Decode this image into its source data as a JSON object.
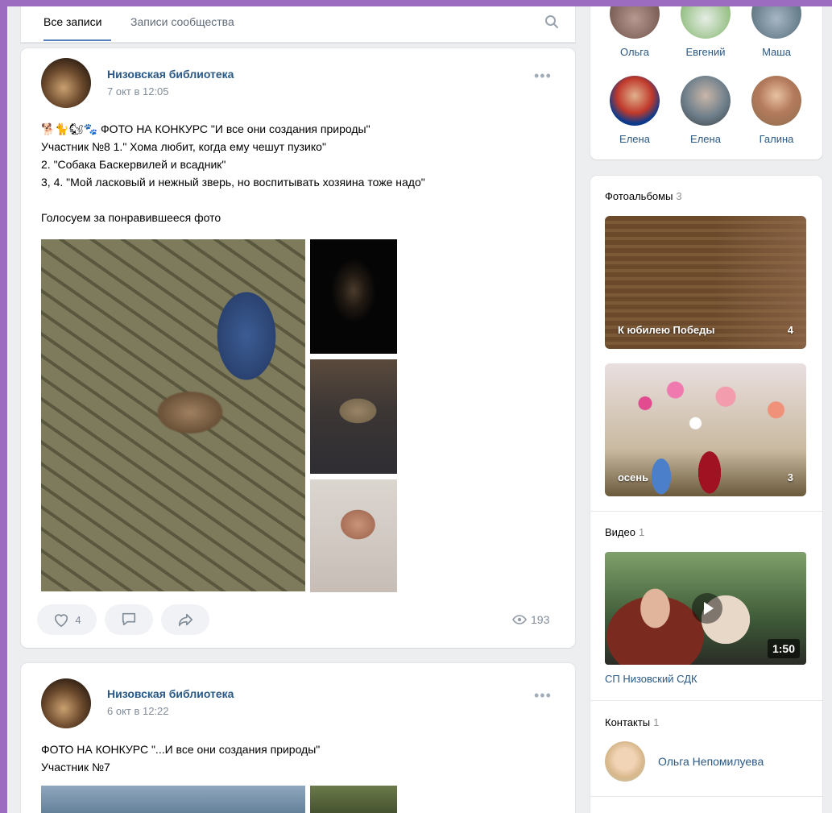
{
  "tabs": {
    "all": "Все записи",
    "community": "Записи сообщества"
  },
  "posts": [
    {
      "author": "Низовская библиотека",
      "date": "7 окт в 12:05",
      "more": "•••",
      "text": "🐕🐈🐿🐾 ФОТО НА КОНКУРС \"И все они создания природы\"\nУчастник №8 1.\" Хома любит, когда ему чешут пузико\"\n2. \"Собака Баскервилей и всадник\"\n3, 4. \"Мой ласковый и нежный зверь, но воспитывать хозяина тоже надо\"\n\nГолосуем за понравившееся фото",
      "likes": "4",
      "views": "193"
    },
    {
      "author": "Низовская библиотека",
      "date": "6 окт в 12:22",
      "more": "•••",
      "text": "ФОТО НА КОНКУРС \"...И все они создания природы\"\nУчастник №7"
    }
  ],
  "friends": [
    "Ольга",
    "Евгений",
    "Маша",
    "Елена",
    "Елена",
    "Галина"
  ],
  "albums": {
    "title": "Фотоальбомы",
    "count": "3",
    "items": [
      {
        "label": "К юбилею Победы",
        "count": "4"
      },
      {
        "label": "осень",
        "count": "3"
      }
    ]
  },
  "video": {
    "title": "Видео",
    "count": "1",
    "duration": "1:50",
    "caption": "СП Низовский СДК"
  },
  "contacts": {
    "title": "Контакты",
    "count": "1",
    "name": "Ольга Непомилуева"
  }
}
